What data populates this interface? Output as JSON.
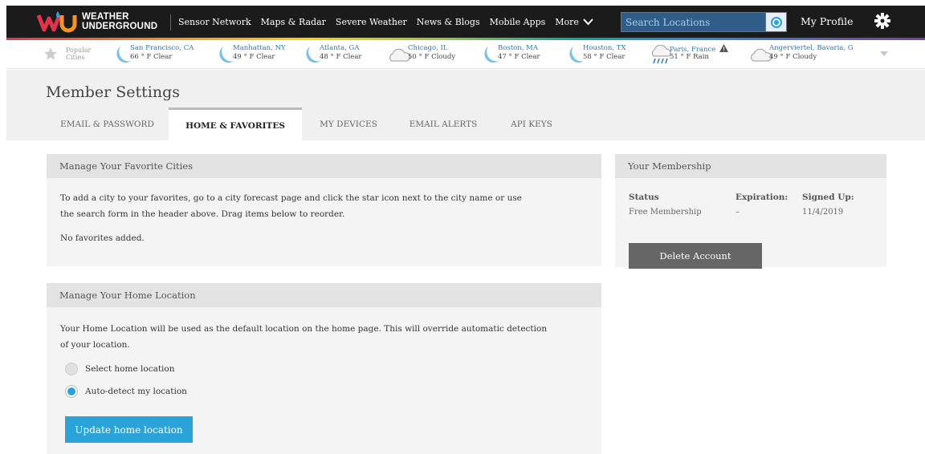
{
  "header": {
    "logo_line1": "WEATHER",
    "logo_line2": "UNDERGROUND",
    "nav": [
      "Sensor Network",
      "Maps & Radar",
      "Severe Weather",
      "News & Blogs",
      "Mobile Apps"
    ],
    "more_label": "More",
    "search_placeholder": "Search Locations",
    "profile_label": "My Profile"
  },
  "popular": {
    "label_line1": "Popular",
    "label_line2": "Cities",
    "cities": [
      {
        "name": "San Francisco, CA",
        "temp": "66 ° F Clear",
        "icon": "moon-icon"
      },
      {
        "name": "Manhattan, NY",
        "temp": "49 ° F Clear",
        "icon": "moon-icon"
      },
      {
        "name": "Atlanta, GA",
        "temp": "48 ° F Clear",
        "icon": "moon-icon"
      },
      {
        "name": "Chicago, IL",
        "temp": "50 ° F Cloudy",
        "icon": "cloud-icon"
      },
      {
        "name": "Boston, MA",
        "temp": "47 ° F Clear",
        "icon": "moon-icon"
      },
      {
        "name": "Houston, TX",
        "temp": "58 ° F Clear",
        "icon": "moon-icon"
      },
      {
        "name": "Paris, France",
        "temp": "51 ° F Rain",
        "icon": "rain-icon"
      },
      {
        "name": "Angerviertel, Bavaria, G",
        "temp": "49 ° F Cloudy",
        "icon": "cloud-icon"
      }
    ]
  },
  "page": {
    "title": "Member Settings",
    "tabs": [
      "EMAIL & PASSWORD",
      "HOME & FAVORITES",
      "MY DEVICES",
      "EMAIL ALERTS",
      "API KEYS"
    ],
    "active_tab": "HOME & FAVORITES"
  },
  "favorites": {
    "heading": "Manage Your Favorite Cities",
    "text_line1": "To add a city to your favorites, go to a city forecast page and click the star icon next to the city name or use",
    "text_line2": "the search form in the header above. Drag items below to reorder.",
    "empty": "No favorites added."
  },
  "home_location": {
    "heading": "Manage Your Home Location",
    "text_line1": "Your Home Location will be used as the default location on the home page. This will override automatic detection",
    "text_line2": "of your location.",
    "options": [
      "Select home location",
      "Auto-detect my location"
    ],
    "selected": "Auto-detect my location",
    "button": "Update home location"
  },
  "membership": {
    "heading": "Your Membership",
    "status_label": "Status",
    "expiration_label": "Expiration:",
    "signed_label": "Signed Up:",
    "status_value": "Free Membership",
    "expiration_value": "–",
    "signed_value": "11/4/2019",
    "delete_button": "Delete Account"
  },
  "colors": {
    "accent_blue": "#2aa3d9",
    "topbar": "#1b1b1b",
    "search_bg": "#2f5d87",
    "link_blue": "#2a7ab8"
  }
}
